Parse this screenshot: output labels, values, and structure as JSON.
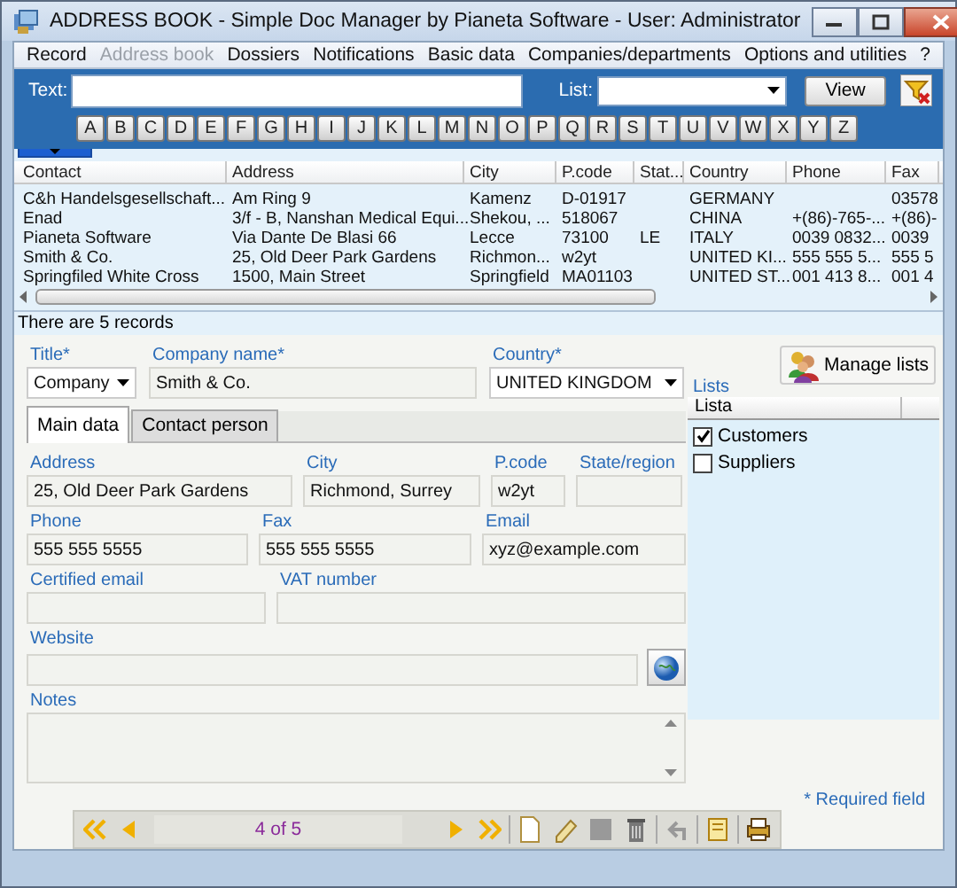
{
  "window": {
    "title": "ADDRESS BOOK - Simple Doc Manager by Pianeta Software - User: Administrator"
  },
  "menu": [
    {
      "label": "Record",
      "disabled": false
    },
    {
      "label": "Address book",
      "disabled": true
    },
    {
      "label": "Dossiers",
      "disabled": false
    },
    {
      "label": "Notifications",
      "disabled": false
    },
    {
      "label": "Basic data",
      "disabled": false
    },
    {
      "label": "Companies/departments",
      "disabled": false
    },
    {
      "label": "Options and utilities",
      "disabled": false
    },
    {
      "label": "?",
      "disabled": false
    }
  ],
  "search": {
    "text_label": "Text:",
    "list_label": "List:",
    "view_button": "View",
    "letters": [
      "A",
      "B",
      "C",
      "D",
      "E",
      "F",
      "G",
      "H",
      "I",
      "J",
      "K",
      "L",
      "M",
      "N",
      "O",
      "P",
      "Q",
      "R",
      "S",
      "T",
      "U",
      "V",
      "W",
      "X",
      "Y",
      "Z"
    ]
  },
  "table": {
    "columns": [
      "Contact",
      "Address",
      "City",
      "P.code",
      "Stat...",
      "Country",
      "Phone",
      "Fax"
    ],
    "rows": [
      [
        "C&h Handelsgesellschaft...",
        "Am Ring 9",
        "Kamenz",
        "D-01917",
        null,
        "GERMANY",
        null,
        "03578"
      ],
      [
        "Enad",
        "3/f - B, Nanshan Medical Equi...",
        "Shekou, ...",
        "518067",
        null,
        "CHINA",
        "+(86)-765-...",
        "+(86)-"
      ],
      [
        "Pianeta Software",
        "Via Dante De Blasi 66",
        "Lecce",
        "73100",
        "LE",
        "ITALY",
        "0039 0832...",
        "0039"
      ],
      [
        "Smith & Co.",
        "25, Old Deer Park Gardens",
        "Richmon...",
        "w2yt",
        null,
        "UNITED KI...",
        "555 555 5...",
        "555 5"
      ],
      [
        "Springfiled White Cross",
        "1500, Main Street",
        "Springfield",
        "MA01103",
        null,
        "UNITED ST...",
        "001 413 8...",
        "001 4"
      ]
    ]
  },
  "status": "There are 5 records",
  "form": {
    "header": [
      {
        "kind": "select",
        "label": "Title*",
        "value": "Company"
      },
      {
        "kind": "text",
        "label": "Company name*",
        "value": "Smith & Co."
      },
      {
        "kind": "select",
        "label": "Country*",
        "value": "UNITED KINGDOM"
      }
    ],
    "tabs": [
      {
        "label": "Main data",
        "selected": true
      },
      {
        "label": "Contact person",
        "selected": false
      }
    ],
    "rows": [
      [
        {
          "kind": "text",
          "label": "Address",
          "value": "25, Old Deer Park Gardens"
        },
        {
          "kind": "text",
          "label": "City",
          "value": "Richmond, Surrey"
        },
        {
          "kind": "text",
          "label": "P.code",
          "value": "w2yt"
        },
        {
          "kind": "text",
          "label": "State/region"
        }
      ],
      [
        {
          "kind": "text",
          "label": "Phone",
          "value": "555 555 5555"
        },
        {
          "kind": "text",
          "label": "Fax",
          "value": "555 555 5555"
        },
        {
          "kind": "text",
          "label": "Email",
          "value": "xyz@example.com"
        }
      ],
      [
        {
          "kind": "text",
          "label": "Certified email"
        },
        {
          "kind": "text",
          "label": "VAT number"
        }
      ],
      [
        {
          "kind": "web",
          "label": "Website"
        }
      ],
      [
        {
          "kind": "memo",
          "label": "Notes"
        }
      ]
    ]
  },
  "lists": {
    "button": "Manage lists",
    "label": "Lists",
    "column": "Lista",
    "items": [
      {
        "label": "Customers",
        "checked": true
      },
      {
        "label": "Suppliers",
        "checked": false
      }
    ]
  },
  "navigator": {
    "position": "4 of 5"
  },
  "required_note": "* Required field"
}
